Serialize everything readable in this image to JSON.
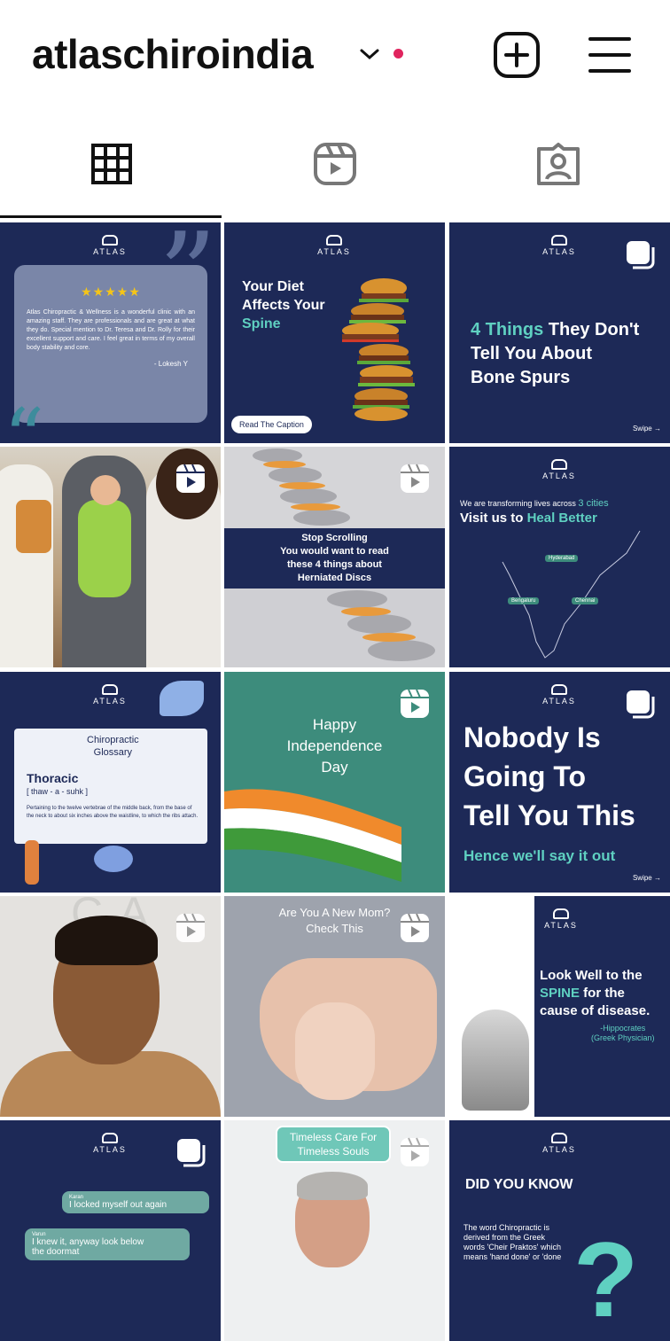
{
  "header": {
    "username": "atlaschiroindia"
  },
  "tabs": [
    {
      "name": "posts",
      "icon": "grid-icon",
      "active": true
    },
    {
      "name": "reels",
      "icon": "reels-icon",
      "active": false
    },
    {
      "name": "tagged",
      "icon": "tagged-icon",
      "active": false
    }
  ],
  "colors": {
    "navy": "#1d2957",
    "teal": "#5fd0c1",
    "green_tile": "#3d8c7c"
  },
  "posts": {
    "p1": {
      "brand": "ATLAS",
      "stars": "★★★★★",
      "review": "Atlas Chiropractic & Wellness is a wonderful clinic with an amazing staff. They are professionals and are great at what they do. Special mention to Dr. Teresa and Dr. Rolly for their excellent support and care. I feel great in terms of my overall body stability and core.",
      "author": "- Lokesh Y"
    },
    "p2": {
      "brand": "ATLAS",
      "line1": "Your Diet",
      "line2": "Affects Your",
      "line3": "Spine",
      "button": "Read The Caption"
    },
    "p3": {
      "brand": "ATLAS",
      "hl": "4 Things",
      "rest1": " They Don't",
      "line2": "Tell You About",
      "line3": "Bone Spurs",
      "swipe": "Swipe"
    },
    "p5": {
      "line1": "Stop Scrolling",
      "line2": "You would want to read",
      "line3": "these 4 things about",
      "line4": "Herniated Discs"
    },
    "p6": {
      "brand": "ATLAS",
      "small_a": "We are transforming lives across ",
      "small_b": "3 cities",
      "big_a": "Visit us to ",
      "big_b": "Heal Better",
      "city1": "Hyderabad",
      "city2": "Bengaluru",
      "city3": "Chennai"
    },
    "p7": {
      "brand": "ATLAS",
      "glossary1": "Chiropractic",
      "glossary2": "Glossary",
      "term": "Thoracic",
      "pron": "[ thaw - a - suhk ]",
      "definition": "Pertaining to the twelve vertebrae of the middle back, from the base of the neck to about six inches above the waistline, to which the ribs attach."
    },
    "p8": {
      "line1": "Happy",
      "line2": "Independence",
      "line3": "Day"
    },
    "p9": {
      "brand": "ATLAS",
      "line1": "Nobody Is",
      "line2": "Going To",
      "line3": "Tell You This",
      "sub": "Hence we'll say it out",
      "swipe": "Swipe"
    },
    "p10": {
      "wall": "CA"
    },
    "p11": {
      "line1": "Are You A New Mom?",
      "line2": "Check This"
    },
    "p12": {
      "brand": "ATLAS",
      "q1": "Look Well to the",
      "q2a": "SPINE",
      "q2b": " for the",
      "q3": "cause of disease.",
      "auth1": "-Hippocrates",
      "auth2": "(Greek Physician)"
    },
    "p13": {
      "brand": "ATLAS",
      "n1": "Karan",
      "m1": "I locked myself out again",
      "n2": "Varun",
      "m2a": "I knew it, anyway look below",
      "m2b": "the doormat"
    },
    "p14": {
      "line1": "Timeless Care For",
      "line2": "Timeless Souls"
    },
    "p15": {
      "brand": "ATLAS",
      "title": "DID YOU KNOW",
      "t1": "The word Chiropractic is",
      "t2": "derived from the Greek",
      "t3": "words 'Cheir Praktos' which",
      "t4": "means 'hand done' or 'done"
    }
  }
}
